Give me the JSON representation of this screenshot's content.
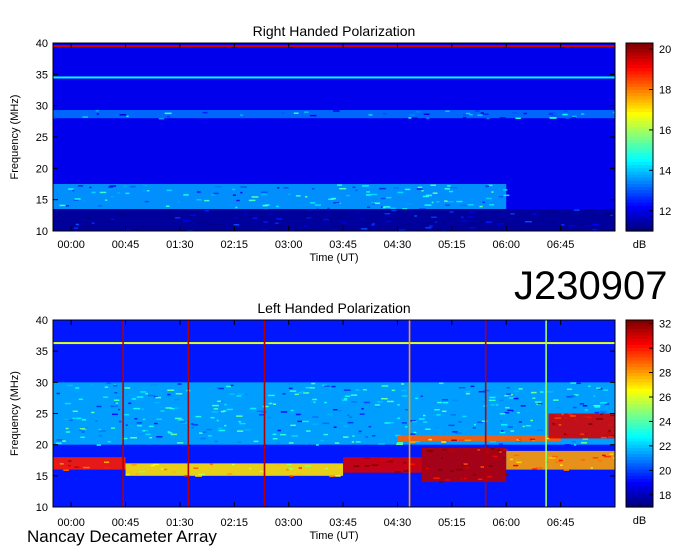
{
  "observation_id": "J230907",
  "instrument": "Nancay Decameter Array",
  "colors": {
    "background": "#000080",
    "burst": "#b00000"
  },
  "chart_data": [
    {
      "type": "heatmap",
      "title": "Right Handed Polarization",
      "xlabel": "Time (UT)",
      "ylabel": "Frequency (MHz)",
      "colorbar_label": "dB",
      "xlim": [
        "23:45",
        "07:30"
      ],
      "ylim": [
        10,
        40
      ],
      "x_ticks": [
        "00:00",
        "00:45",
        "01:30",
        "02:15",
        "03:00",
        "03:45",
        "04:30",
        "05:15",
        "06:00",
        "06:45"
      ],
      "y_ticks": [
        10,
        15,
        20,
        25,
        30,
        35,
        40
      ],
      "colorbar_range": [
        11,
        20.3
      ],
      "colorbar_ticks": [
        12,
        14,
        16,
        18,
        20
      ],
      "colormap": "jet",
      "features": [
        {
          "kind": "hline",
          "freq": 39.5,
          "db": 19.5,
          "from": "23:45",
          "to": "07:30"
        },
        {
          "kind": "hline",
          "freq": 34.5,
          "db": 14.5,
          "from": "23:45",
          "to": "07:30"
        },
        {
          "kind": "band",
          "freq": [
            28,
            29.3
          ],
          "db": 13.2,
          "from": "23:45",
          "to": "07:30"
        },
        {
          "kind": "band",
          "freq": [
            13.5,
            17.5
          ],
          "db": 13.6,
          "from": "23:45",
          "to": "06:00"
        },
        {
          "kind": "band",
          "freq": [
            10,
            13.5
          ],
          "db": 11.2,
          "from": "23:45",
          "to": "07:30"
        }
      ]
    },
    {
      "type": "heatmap",
      "title": "Left Handed Polarization",
      "xlabel": "Time (UT)",
      "ylabel": "Frequency (MHz)",
      "colorbar_label": "dB",
      "xlim": [
        "23:45",
        "07:30"
      ],
      "ylim": [
        10,
        40
      ],
      "x_ticks": [
        "00:00",
        "00:45",
        "01:30",
        "02:15",
        "03:00",
        "03:45",
        "04:30",
        "05:15",
        "06:00",
        "06:45"
      ],
      "y_ticks": [
        10,
        15,
        20,
        25,
        30,
        35,
        40
      ],
      "colorbar_range": [
        17,
        32.3
      ],
      "colorbar_ticks": [
        18,
        20,
        22,
        24,
        26,
        28,
        30,
        32
      ],
      "colormap": "jet",
      "features": [
        {
          "kind": "hline",
          "freq": 36.3,
          "db": 26,
          "from": "23:45",
          "to": "07:30"
        },
        {
          "kind": "band",
          "freq": [
            20,
            30
          ],
          "db": 21.5,
          "from": "23:45",
          "to": "07:30"
        },
        {
          "kind": "band",
          "freq": [
            16,
            18
          ],
          "db": 30,
          "from": "23:45",
          "to": "00:45"
        },
        {
          "kind": "band",
          "freq": [
            15,
            17
          ],
          "db": 27,
          "from": "00:45",
          "to": "03:45"
        },
        {
          "kind": "band",
          "freq": [
            15.5,
            18
          ],
          "db": 31,
          "from": "03:45",
          "to": "04:50"
        },
        {
          "kind": "band",
          "freq": [
            14,
            19.5
          ],
          "db": 31.5,
          "from": "04:50",
          "to": "06:00"
        },
        {
          "kind": "band",
          "freq": [
            20.5,
            21.5
          ],
          "db": 29,
          "from": "04:30",
          "to": "06:45"
        },
        {
          "kind": "band",
          "freq": [
            21,
            25
          ],
          "db": 31,
          "from": "06:35",
          "to": "07:30"
        },
        {
          "kind": "band",
          "freq": [
            16,
            19
          ],
          "db": 28,
          "from": "06:00",
          "to": "07:30"
        },
        {
          "kind": "vline",
          "time": "00:43",
          "db": 31.5
        },
        {
          "kind": "vline",
          "time": "01:37",
          "db": 31.5
        },
        {
          "kind": "vline",
          "time": "02:40",
          "db": 31.5
        },
        {
          "kind": "vline",
          "time": "04:40",
          "db": 28
        },
        {
          "kind": "vline",
          "time": "05:43",
          "db": 31.5
        },
        {
          "kind": "vline",
          "time": "06:33",
          "db": 25
        }
      ]
    }
  ]
}
